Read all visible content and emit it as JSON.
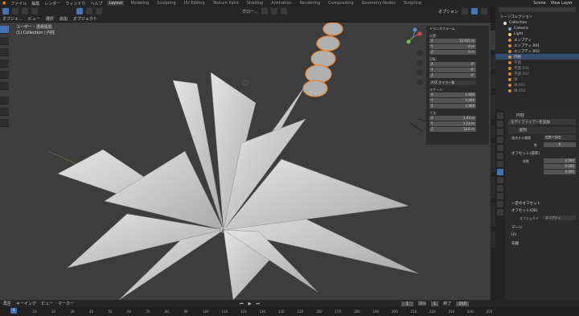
{
  "menu": {
    "items": [
      "ファイル",
      "編集",
      "レンダー",
      "ウィンドウ",
      "ヘルプ"
    ],
    "workspaces": [
      "Layout",
      "Modeling",
      "Sculpting",
      "UV Editing",
      "Texture Paint",
      "Shading",
      "Animation",
      "Rendering",
      "Compositing",
      "Geometry Nodes",
      "Scripting"
    ],
    "active_workspace": "Layout",
    "scene": "Scene",
    "view_layer": "View Layer"
  },
  "header": {
    "mode": "オブジェ...",
    "menus": [
      "ビュー",
      "選択",
      "追加",
      "オブジェクト"
    ],
    "transform": "グロー...",
    "options": "オプション"
  },
  "viewport": {
    "view_name": "ユーザー・透視投影",
    "collection_info": "(1) Collection | 円柱"
  },
  "npanel": {
    "title": "トランスフォーム",
    "location_label": "位置:",
    "location": [
      {
        "k": "X",
        "v": "12.911 m"
      },
      {
        "k": "Y",
        "v": "0 m"
      },
      {
        "k": "Z",
        "v": "0 m"
      }
    ],
    "rotation_label": "回転:",
    "rotation": [
      {
        "k": "X",
        "v": "0°"
      },
      {
        "k": "Y",
        "v": "0°"
      },
      {
        "k": "Z",
        "v": "0°"
      }
    ],
    "euler_label": "XYZ オイラー角",
    "scale_label": "スケール:",
    "scale": [
      {
        "k": "X",
        "v": "1.066"
      },
      {
        "k": "Y",
        "v": "1.066"
      },
      {
        "k": "Z",
        "v": "1.066"
      }
    ],
    "dims_label": "寸法:",
    "dims": [
      {
        "k": "X",
        "v": "1.43 m"
      },
      {
        "k": "Y",
        "v": "1.53 m"
      },
      {
        "k": "Z",
        "v": "10.6 m"
      }
    ],
    "tabs": [
      "アイテム",
      "ツール",
      "ビュー",
      "BPS",
      "Edit",
      "Node Wrangler",
      "MeasureIt",
      "BlenderKit",
      "Tissue"
    ]
  },
  "outliner": {
    "title": "シーンコレクション",
    "rows": [
      "Collection",
      "Camera",
      "Light",
      "エンプティ",
      "エンプティ.001",
      "エンプティ.002",
      "円柱",
      "平面",
      "平面.001",
      "平面.002",
      "球",
      "球.001",
      "球.002"
    ],
    "selected": "円柱"
  },
  "properties": {
    "object": "円柱",
    "add_modifier": "モディファイアーを追加",
    "modifier": "配列",
    "fit_type_label": "適合する種類",
    "fit_type": "定数で指定",
    "count_label": "数",
    "count": "6",
    "offset_section": "オフセット(倍率)",
    "factor_label": "係数",
    "factor": [
      "0.000",
      "0.000",
      "4.000"
    ],
    "const_offset": "一定のオフセット",
    "obj_offset": "オフセット(OB)",
    "obj_label": "オブジェクト",
    "obj_value": "エンプティ",
    "merge": "マージ",
    "uv": "UV",
    "caps": "先端"
  },
  "timeline": {
    "menus": [
      "再生",
      "キーイング",
      "ビュー",
      "マーカー"
    ],
    "frame": "1",
    "start_label": "開始",
    "start": "1",
    "end_label": "終了",
    "end": "250",
    "ticks": [
      "0",
      "10",
      "20",
      "30",
      "40",
      "50",
      "60",
      "70",
      "80",
      "90",
      "100",
      "110",
      "120",
      "130",
      "140",
      "150",
      "160",
      "170",
      "180",
      "190",
      "200",
      "210",
      "220",
      "230",
      "240",
      "250"
    ]
  },
  "colors": {
    "accent": "#4772b3",
    "selection": "#e8822c",
    "viewport_bg": "#3d3d3d"
  }
}
